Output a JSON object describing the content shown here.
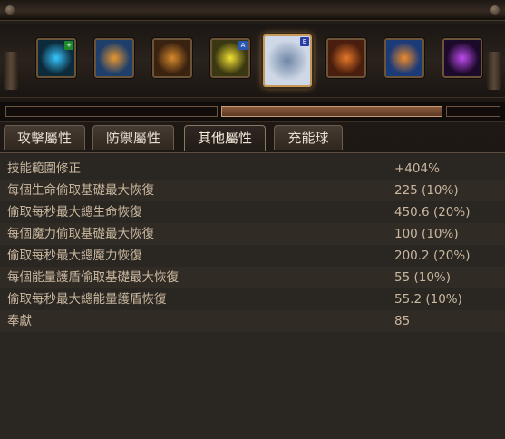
{
  "skills": [
    {
      "name": "lightning-tendrils-skill-icon",
      "bg": "#0c2a3a",
      "accent": "#38c6ff",
      "badge": "+",
      "badge_color": "#1c8a2a"
    },
    {
      "name": "fist-skill-icon-1",
      "bg": "#1e3f6b",
      "accent": "#e9962e"
    },
    {
      "name": "mana-steal-skill-icon",
      "bg": "#3a2210",
      "accent": "#d88a2c"
    },
    {
      "name": "lightning-warrior-skill-icon",
      "bg": "#3a3812",
      "accent": "#f3e133",
      "badge": "A",
      "badge_color": "#2a56b4"
    },
    {
      "name": "ice-claw-skill-icon",
      "bg": "#cfd8e6",
      "accent": "#6f86a6",
      "badge": "E",
      "badge_color": "#2a3ea8",
      "selected": true
    },
    {
      "name": "fist-skill-icon-2",
      "bg": "#4a1e0e",
      "accent": "#e6782a"
    },
    {
      "name": "fist-skill-icon-3",
      "bg": "#1a3a78",
      "accent": "#f08a2a"
    },
    {
      "name": "void-sphere-skill-icon",
      "bg": "#1c0a2a",
      "accent": "#c04bf0"
    }
  ],
  "tabs": [
    {
      "label": "攻擊屬性",
      "active": false
    },
    {
      "label": "防禦屬性",
      "active": false
    },
    {
      "label": "其他屬性",
      "active": true
    },
    {
      "label": "充能球",
      "active": false
    }
  ],
  "stats": [
    {
      "label": "技能範圍修正",
      "value": "+404%"
    },
    {
      "label": "每個生命偷取基礎最大恢復",
      "value": "225 (10%)"
    },
    {
      "label": "偷取每秒最大總生命恢復",
      "value": "450.6 (20%)"
    },
    {
      "label": "每個魔力偷取基礎最大恢復",
      "value": "100 (10%)"
    },
    {
      "label": "偷取每秒最大總魔力恢復",
      "value": "200.2 (20%)"
    },
    {
      "label": "每個能量護盾偷取基礎最大恢復",
      "value": "55 (10%)"
    },
    {
      "label": "偷取每秒最大總能量護盾恢復",
      "value": "55.2 (10%)"
    },
    {
      "label": "奉獻",
      "value": "85"
    }
  ]
}
